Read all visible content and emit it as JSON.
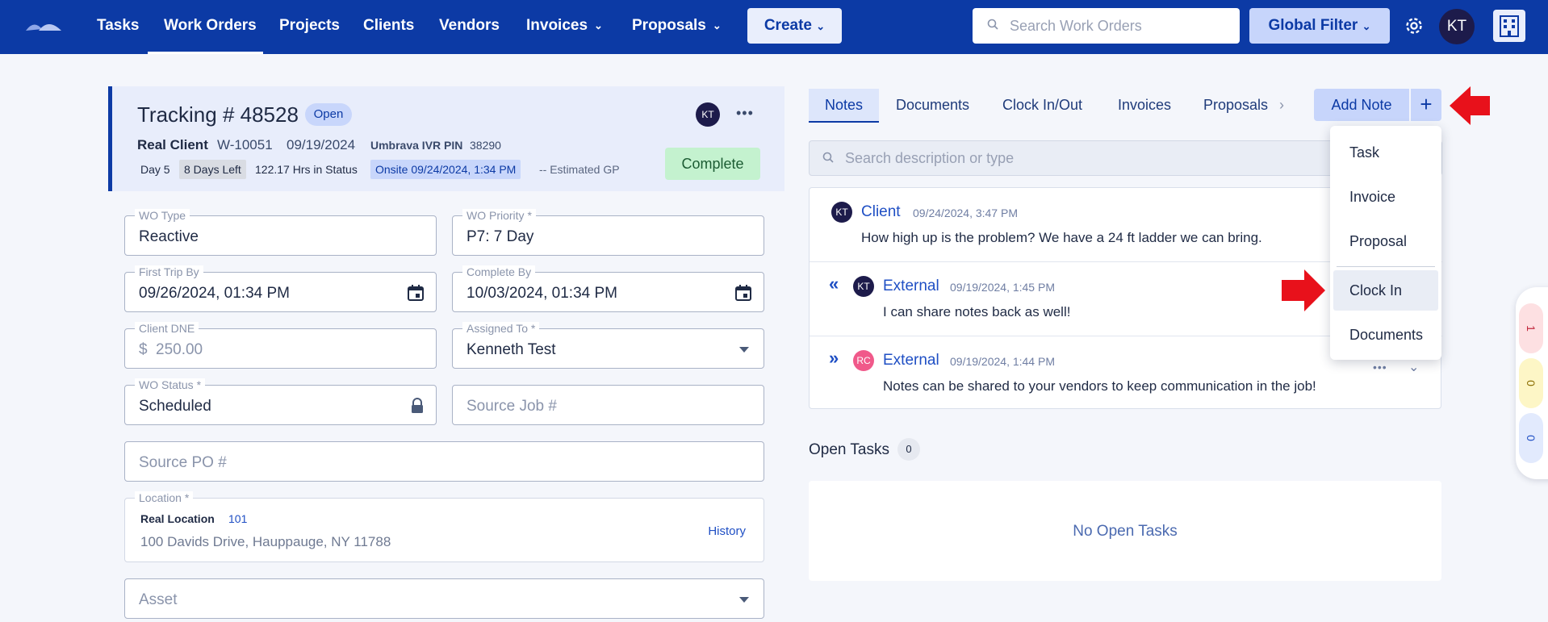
{
  "nav": {
    "items": [
      {
        "label": "Tasks"
      },
      {
        "label": "Work Orders"
      },
      {
        "label": "Projects"
      },
      {
        "label": "Clients"
      },
      {
        "label": "Vendors"
      },
      {
        "label": "Invoices"
      },
      {
        "label": "Proposals"
      }
    ],
    "create_label": "Create",
    "search_placeholder": "Search Work Orders",
    "global_filter_label": "Global Filter",
    "user_initials": "KT"
  },
  "work_order": {
    "title": "Tracking # 48528",
    "status_badge": "Open",
    "owner_initials": "KT",
    "client": "Real Client",
    "wo_number": "W-10051",
    "date": "09/19/2024",
    "ivr_label": "Umbrava IVR PIN",
    "ivr_pin": "38290",
    "chips": {
      "day": "Day 5",
      "days_left": "8 Days Left",
      "hrs_in_status": "122.17 Hrs in Status",
      "onsite": "Onsite 09/24/2024, 1:34 PM",
      "estimated_gp": "-- Estimated GP"
    },
    "complete_label": "Complete"
  },
  "form": {
    "wo_type": {
      "label": "WO Type",
      "value": "Reactive"
    },
    "wo_priority": {
      "label": "WO Priority *",
      "value": "P7: 7 Day"
    },
    "first_trip_by": {
      "label": "First Trip By",
      "value": "09/26/2024, 01:34 PM"
    },
    "complete_by": {
      "label": "Complete By",
      "value": "10/03/2024, 01:34 PM"
    },
    "client_dne": {
      "label": "Client DNE",
      "prefix": "$",
      "value": "250.00"
    },
    "assigned_to": {
      "label": "Assigned To *",
      "value": "Kenneth Test"
    },
    "wo_status": {
      "label": "WO Status *",
      "value": "Scheduled"
    },
    "source_job": {
      "placeholder": "Source Job #"
    },
    "source_po": {
      "placeholder": "Source PO #"
    },
    "location": {
      "label": "Location *",
      "name": "Real Location",
      "code": "101",
      "address": "100 Davids Drive, Hauppauge, NY 11788",
      "history_label": "History"
    },
    "asset": {
      "placeholder": "Asset"
    }
  },
  "right": {
    "tabs": [
      {
        "label": "Notes"
      },
      {
        "label": "Documents"
      },
      {
        "label": "Clock In/Out"
      },
      {
        "label": "Invoices"
      },
      {
        "label": "Proposals"
      }
    ],
    "add_note_label": "Add Note",
    "plus_label": "+",
    "search_placeholder": "Search description or type",
    "notes": [
      {
        "initials": "KT",
        "author": "Client",
        "time": "09/24/2024, 3:47 PM",
        "text": "How high up is the problem? We have a 24 ft ladder we can bring."
      },
      {
        "initials": "KT",
        "author": "External",
        "time": "09/19/2024, 1:45 PM",
        "text": "I can share notes back as well!"
      },
      {
        "initials": "RC",
        "author": "External",
        "time": "09/19/2024, 1:44 PM",
        "text": "Notes can be shared to your vendors to keep communication in the job!"
      }
    ],
    "open_tasks_label": "Open Tasks",
    "open_tasks_count": "0",
    "no_tasks_label": "No Open Tasks"
  },
  "dropdown": {
    "items": [
      {
        "label": "Task"
      },
      {
        "label": "Invoice"
      },
      {
        "label": "Proposal"
      },
      {
        "label": "Clock In"
      },
      {
        "label": "Documents"
      }
    ]
  },
  "side_pills": {
    "red": "1",
    "yellow": "0",
    "blue": "0"
  },
  "colors": {
    "nav_bg": "#0c3aa5",
    "accent": "#0c3aa5",
    "complete_bg": "#c4f2cf",
    "arrow_red": "#e8111b"
  }
}
